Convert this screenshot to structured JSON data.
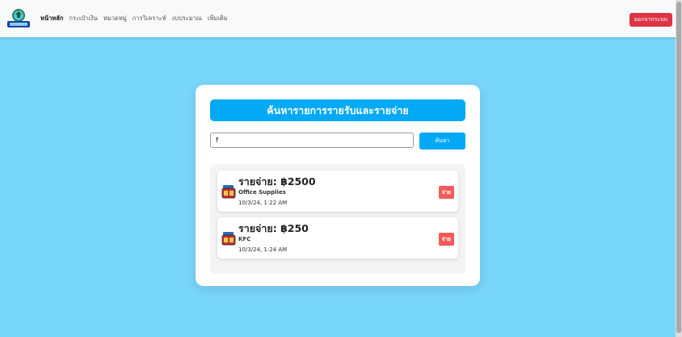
{
  "navbar": {
    "links": [
      "หน้าหลัก",
      "กระเป๋าเงิน",
      "หมวดหมู่",
      "การวิเคราะห์",
      "งบประมาณ",
      "เพิ่มเติม"
    ],
    "logout_label": "ออกจากระบบ"
  },
  "main": {
    "title": "ค้นหารายการรายรับและรายจ่าย",
    "search": {
      "value": "f",
      "button_label": "ค้นหา"
    },
    "results": [
      {
        "amount": "รายจ่าย: ฿2500",
        "name": "Office Supplies",
        "time": "10/3/24, 1:22 AM",
        "badge": "จ่าย"
      },
      {
        "amount": "รายจ่าย: ฿250",
        "name": "KFC",
        "time": "10/3/24, 1:24 AM",
        "badge": "จ่าย"
      }
    ]
  },
  "colors": {
    "page_bg": "#79d6fb",
    "accent": "#03a9f4",
    "logout": "#dc3545",
    "badge": "#f15b5b"
  }
}
